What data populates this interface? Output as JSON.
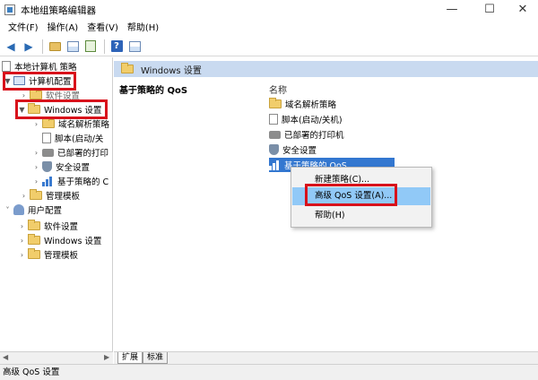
{
  "window": {
    "title": "本地组策略编辑器",
    "minimize": "—",
    "maximize": "☐",
    "close": "✕"
  },
  "menubar": [
    "文件(F)",
    "操作(A)",
    "查看(V)",
    "帮助(H)"
  ],
  "tree": {
    "root": "本地计算机 策略",
    "computer_config": "计算机配置",
    "software_settings_partial": "软件设置",
    "windows_settings": "Windows 设置",
    "windows_children": [
      "域名解析策略",
      "脚本(启动/关",
      "已部署的打印",
      "安全设置",
      "基于策略的 C"
    ],
    "admin_templates": "管理模板",
    "user_config": "用户配置",
    "user_children": [
      "软件设置",
      "Windows 设置",
      "管理模板"
    ]
  },
  "right": {
    "header": "Windows 设置",
    "description_title": "基于策略的 QoS",
    "column_name": "名称",
    "items": [
      "域名解析策略",
      "脚本(启动/关机)",
      "已部署的打印机",
      "安全设置",
      "基于策略的 QoS"
    ],
    "selected_index": 4
  },
  "context_menu": [
    "新建策略(C)...",
    "高级 QoS 设置(A)...",
    "帮助(H)"
  ],
  "bottom_tabs": [
    "扩展",
    "标准"
  ],
  "status": "高级 QoS 设置",
  "colors": {
    "highlight_red": "#d8121b",
    "header_blue": "#c9daf0",
    "selection_blue": "#3377d0",
    "menu_hover": "#91c9f7"
  }
}
